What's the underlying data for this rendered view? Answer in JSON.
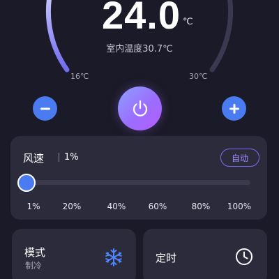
{
  "thermostat": {
    "set_temp": "24.0",
    "unit": "℃",
    "room_temp_label": "室内温度30.7℃",
    "min_label": "16℃",
    "max_label": "30℃",
    "set_fraction": 0.57
  },
  "controls": {
    "decrease_icon": "minus-icon",
    "increase_icon": "plus-icon",
    "power_icon": "power-icon"
  },
  "fan": {
    "title": "风速",
    "value": "1%",
    "auto_label": "自动",
    "level_percent": 1,
    "scale": [
      "1%",
      "20%",
      "40%",
      "60%",
      "80%",
      "100%"
    ]
  },
  "mode": {
    "title": "模式",
    "value": "制冷",
    "icon": "snowflake-icon"
  },
  "timer": {
    "title": "定时",
    "icon": "clock-icon"
  },
  "colors": {
    "background": "#1b1a28",
    "card": "#2c2b3c",
    "accent_blue": "#4a7bf0",
    "accent_purple": "#9b6dff"
  }
}
